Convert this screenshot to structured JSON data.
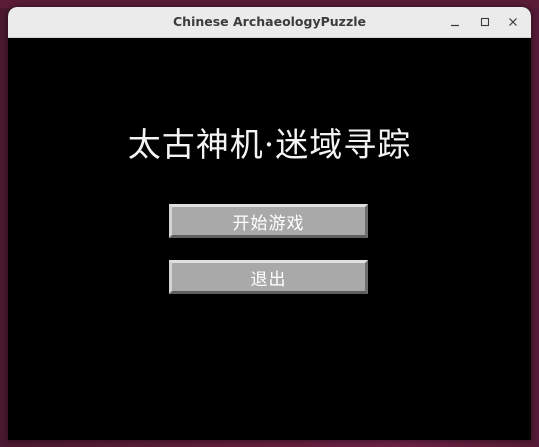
{
  "window": {
    "title": "Chinese ArchaeologyPuzzle"
  },
  "game": {
    "title": "太古神机·迷域寻踪"
  },
  "menu": {
    "start_label": "开始游戏",
    "exit_label": "退出"
  },
  "icons": {
    "minimize": "minimize-icon",
    "maximize": "maximize-icon",
    "close": "close-icon"
  },
  "colors": {
    "titlebar": "#ebebeb",
    "canvas": "#000000",
    "button_face": "#a9a9a9",
    "button_text": "#ffffff",
    "title_text": "#f4f4f4"
  }
}
